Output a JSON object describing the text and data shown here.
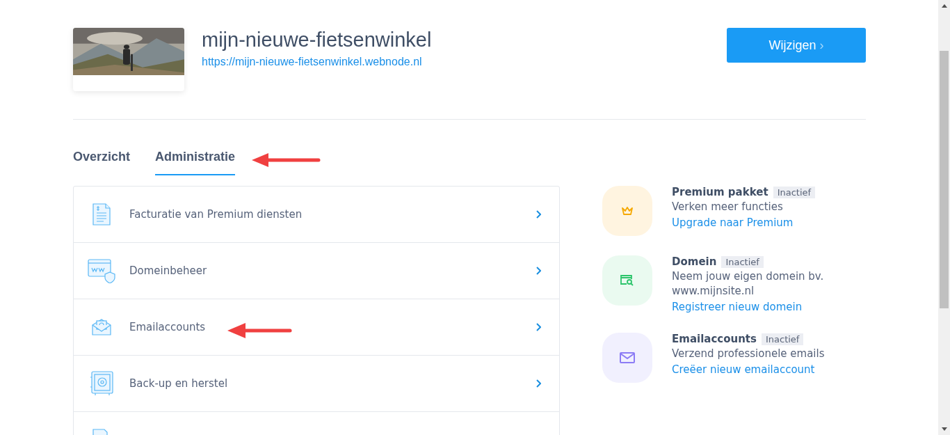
{
  "site": {
    "title": "mijn-nieuwe-fietsenwinkel",
    "url": "https://mijn-nieuwe-fietsenwinkel.webnode.nl",
    "button": "Wijzigen",
    "button_icon": "›"
  },
  "tabs": [
    {
      "label": "Overzicht",
      "selected": false
    },
    {
      "label": "Administratie",
      "selected": true
    }
  ],
  "menu": [
    {
      "kind": "invoice",
      "label": "Facturatie van Premium diensten"
    },
    {
      "kind": "domain",
      "label": "Domeinbeheer"
    },
    {
      "kind": "email",
      "label": "Emailaccounts"
    },
    {
      "kind": "backup",
      "label": "Back-up en herstel"
    },
    {
      "kind": "document"
    }
  ],
  "services": [
    {
      "kind": "crown",
      "color": "#fff4e0",
      "title": "Premium pakket",
      "badge": "Inactief",
      "lines": [
        "Verken meer functies"
      ],
      "link": "Upgrade naar Premium"
    },
    {
      "kind": "domain",
      "color": "#eafaf0",
      "title": "Domein",
      "badge": "Inactief",
      "lines": [
        "Neem jouw eigen domein bv.",
        "www.mijnsite.nl"
      ],
      "link": "Registreer nieuw domein"
    },
    {
      "kind": "mail",
      "color": "#f1f0fe",
      "title": "Emailaccounts",
      "badge": "Inactief",
      "lines": [
        "Verzend professionele emails"
      ],
      "link": "Creëer nieuw emailaccount"
    }
  ]
}
